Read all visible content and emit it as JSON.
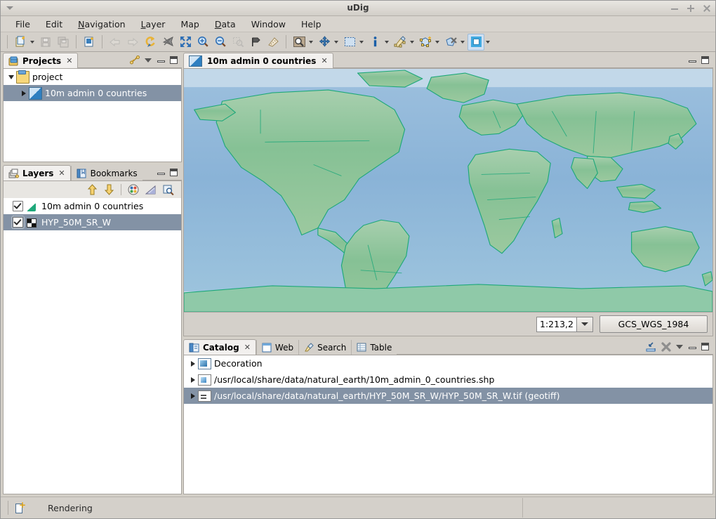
{
  "window": {
    "title": "uDig",
    "controls": {
      "minimize": "Minimize",
      "maximize": "Maximize",
      "close": "Close"
    }
  },
  "menubar": {
    "items": [
      {
        "label": "File",
        "mnemonic": ""
      },
      {
        "label": "Edit",
        "mnemonic": ""
      },
      {
        "label": "Navigation",
        "mnemonic": "N"
      },
      {
        "label": "Layer",
        "mnemonic": "L"
      },
      {
        "label": "Map",
        "mnemonic": ""
      },
      {
        "label": "Data",
        "mnemonic": "D"
      },
      {
        "label": "Window",
        "mnemonic": ""
      },
      {
        "label": "Help",
        "mnemonic": ""
      }
    ]
  },
  "toolbar": {
    "items": [
      {
        "name": "new-map",
        "icon": "new-document-icon",
        "enabled": true,
        "dropdown": true
      },
      {
        "name": "save",
        "icon": "save-icon",
        "enabled": false,
        "dropdown": false
      },
      {
        "name": "save-all",
        "icon": "save-all-icon",
        "enabled": false,
        "dropdown": false
      },
      {
        "name": "new-project",
        "icon": "new-project-icon",
        "enabled": true,
        "dropdown": false
      },
      {
        "name": "back",
        "icon": "arrow-left-icon",
        "enabled": false,
        "dropdown": false
      },
      {
        "name": "forward",
        "icon": "arrow-right-icon",
        "enabled": false,
        "dropdown": false
      },
      {
        "name": "refresh",
        "icon": "refresh-icon",
        "enabled": true,
        "dropdown": false
      },
      {
        "name": "stop-rendering",
        "icon": "stop-render-icon",
        "enabled": true,
        "dropdown": false
      },
      {
        "name": "zoom-to-extent",
        "icon": "zoom-extent-icon",
        "enabled": true,
        "dropdown": false
      },
      {
        "name": "zoom-in",
        "icon": "zoom-in-icon",
        "enabled": true,
        "dropdown": false
      },
      {
        "name": "zoom-out",
        "icon": "zoom-out-icon",
        "enabled": true,
        "dropdown": false
      },
      {
        "name": "zoom-to-selection",
        "icon": "zoom-selection-icon",
        "enabled": false,
        "dropdown": false
      },
      {
        "name": "show-layer",
        "icon": "flag-icon",
        "enabled": true,
        "dropdown": false
      },
      {
        "name": "measure",
        "icon": "measure-icon",
        "enabled": true,
        "dropdown": false
      },
      {
        "name": "pan-select",
        "icon": "select-tool-icon",
        "enabled": true,
        "dropdown": true
      },
      {
        "name": "pan",
        "icon": "pan-icon",
        "enabled": true,
        "dropdown": true
      },
      {
        "name": "bbox-select",
        "icon": "bbox-select-icon",
        "enabled": true,
        "dropdown": true
      },
      {
        "name": "info",
        "icon": "info-icon",
        "enabled": true,
        "dropdown": true
      },
      {
        "name": "edit-geometry",
        "icon": "edit-geometry-icon",
        "enabled": true,
        "dropdown": true
      },
      {
        "name": "create-feature",
        "icon": "create-feature-icon",
        "enabled": true,
        "dropdown": true
      },
      {
        "name": "delete-feature",
        "icon": "delete-feature-icon",
        "enabled": true,
        "dropdown": true
      },
      {
        "name": "fill-style",
        "icon": "fill-style-icon",
        "enabled": true,
        "dropdown": true,
        "active": true
      }
    ]
  },
  "projects_view": {
    "tab_label": "Projects",
    "tab_icon": "projects-icon",
    "close_glyph": "✕",
    "toolbar": [
      {
        "name": "link-with-editor",
        "icon": "link-icon"
      },
      {
        "name": "view-menu",
        "icon": "chevron-down-icon"
      },
      {
        "name": "minimize-view",
        "icon": "minimize-icon"
      },
      {
        "name": "maximize-view",
        "icon": "maximize-icon"
      }
    ],
    "tree": [
      {
        "label": "project",
        "icon": "project-folder-icon",
        "expanded": true,
        "indent": 0,
        "selected": false
      },
      {
        "label": "10m admin 0 countries",
        "icon": "map-icon",
        "expanded": false,
        "indent": 1,
        "selected": true
      }
    ]
  },
  "layers_view": {
    "tabs": [
      {
        "label": "Layers",
        "icon": "layers-icon",
        "active": true,
        "closable": true
      },
      {
        "label": "Bookmarks",
        "icon": "bookmarks-icon",
        "active": false,
        "closable": false
      }
    ],
    "close_glyph": "✕",
    "header_tools": [
      {
        "name": "minimize-view",
        "icon": "minimize-icon"
      },
      {
        "name": "maximize-view",
        "icon": "maximize-icon"
      }
    ],
    "toolbar": [
      {
        "name": "move-layer-up",
        "icon": "arrow-up-icon"
      },
      {
        "name": "move-layer-down",
        "icon": "arrow-down-icon"
      },
      {
        "name": "layer-style",
        "icon": "palette-icon"
      },
      {
        "name": "layer-transparency",
        "icon": "ramp-icon"
      },
      {
        "name": "zoom-to-layer",
        "icon": "zoom-layer-icon"
      }
    ],
    "layers": [
      {
        "label": "10m admin 0 countries",
        "icon": "vector-layer-icon",
        "checked": true,
        "selected": false
      },
      {
        "label": "HYP_50M_SR_W",
        "icon": "raster-layer-icon",
        "checked": true,
        "selected": true
      }
    ]
  },
  "map_editor": {
    "tab_label": "10m admin 0 countries",
    "tab_icon": "map-icon",
    "close_glyph": "✕",
    "header_tools": [
      {
        "name": "minimize-editor",
        "icon": "minimize-icon"
      },
      {
        "name": "maximize-editor",
        "icon": "maximize-icon"
      }
    ],
    "scale": {
      "value": "1:213,2",
      "dropdown_icon": "chevron-down-icon"
    },
    "crs_label": "GCS_WGS_1984"
  },
  "catalog_view": {
    "tabs": [
      {
        "label": "Catalog",
        "icon": "catalog-icon",
        "active": true,
        "closable": true
      },
      {
        "label": "Web",
        "icon": "web-icon",
        "active": false,
        "closable": false
      },
      {
        "label": "Search",
        "icon": "search-icon",
        "active": false,
        "closable": false
      },
      {
        "label": "Table",
        "icon": "table-icon",
        "active": false,
        "closable": false
      }
    ],
    "close_glyph": "✕",
    "toolbar": [
      {
        "name": "import-data",
        "icon": "import-icon"
      },
      {
        "name": "remove-entry",
        "icon": "remove-x-icon"
      },
      {
        "name": "view-menu",
        "icon": "chevron-down-icon"
      },
      {
        "name": "minimize-view",
        "icon": "minimize-icon"
      },
      {
        "name": "maximize-view",
        "icon": "maximize-icon"
      }
    ],
    "rows": [
      {
        "label": "Decoration",
        "icon": "decoration-icon",
        "selected": false
      },
      {
        "label": "/usr/local/share/data/natural_earth/10m_admin_0_countries.shp",
        "icon": "shapefile-icon",
        "selected": false
      },
      {
        "label": "/usr/local/share/data/natural_earth/HYP_50M_SR_W/HYP_50M_SR_W.tif (geotiff)",
        "icon": "geotiff-icon",
        "selected": true
      }
    ]
  },
  "statusbar": {
    "icon": "new-item-icon",
    "text": "Rendering"
  },
  "colors": {
    "ocean": "#8db6d9",
    "ocean_deep": "#7fa9cf",
    "land_green": "#8fc49a",
    "land_border": "#1ea87a",
    "selection": "#8392a5",
    "chrome": "#d4d0ca",
    "accent_yellow": "#e8b339"
  }
}
